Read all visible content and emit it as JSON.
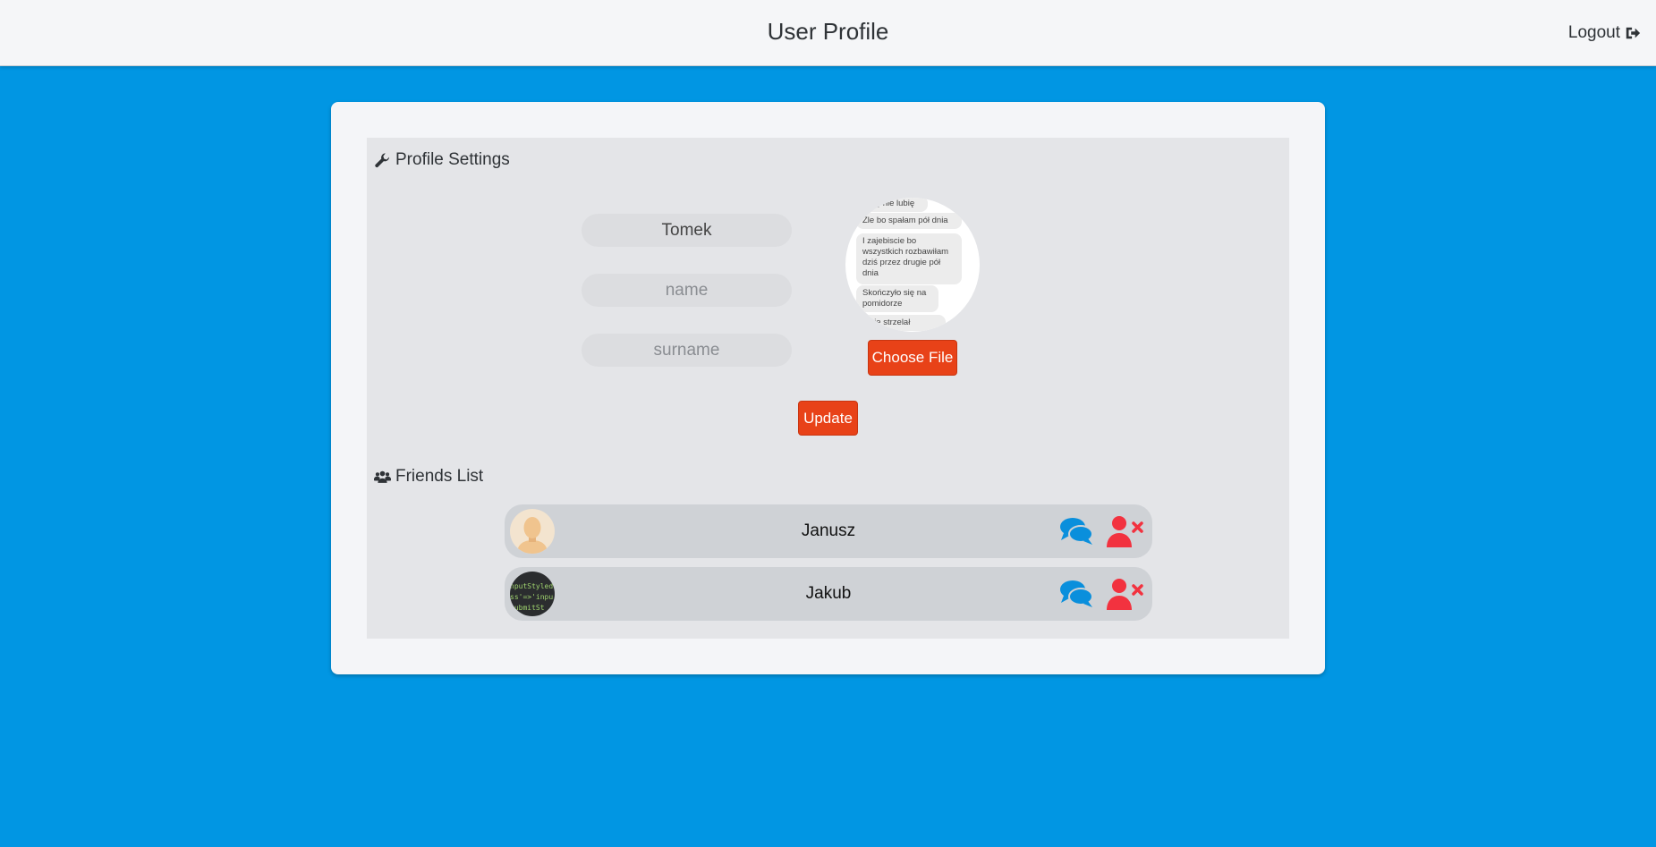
{
  "header": {
    "title": "User Profile",
    "logout_label": "Logout"
  },
  "profile_settings": {
    "heading": "Profile Settings",
    "username_value": "Tomek",
    "name_placeholder": "name",
    "surname_placeholder": "surname",
    "avatar_preview_lines": [
      "lubię nie lubię",
      "Źle bo spałam pół dnia",
      "I zajebiscie bo wszystkich rozbawiłam dziś przez drugie pół dnia",
      "Skończyło się na pomidorze",
      "mnie strzelał"
    ],
    "choose_file_label": "Choose File",
    "update_label": "Update"
  },
  "friends": {
    "heading": "Friends List",
    "items": [
      {
        "name": "Janusz",
        "avatar": "default-person-avatar"
      },
      {
        "name": "Jakub",
        "avatar": "code-snippet-avatar",
        "avatar_text": [
          "nputStyled",
          "ss'=>'inpu",
          "submitSt"
        ]
      }
    ]
  },
  "colors": {
    "background": "#0196e3",
    "accent": "#e84218",
    "chat_icon": "#0a8fdc",
    "remove_icon": "#f2323f"
  },
  "icons": {
    "logout": "sign-out-icon",
    "settings": "wrench-icon",
    "friends": "users-icon",
    "chat": "comments-icon",
    "remove": "user-times-icon"
  }
}
